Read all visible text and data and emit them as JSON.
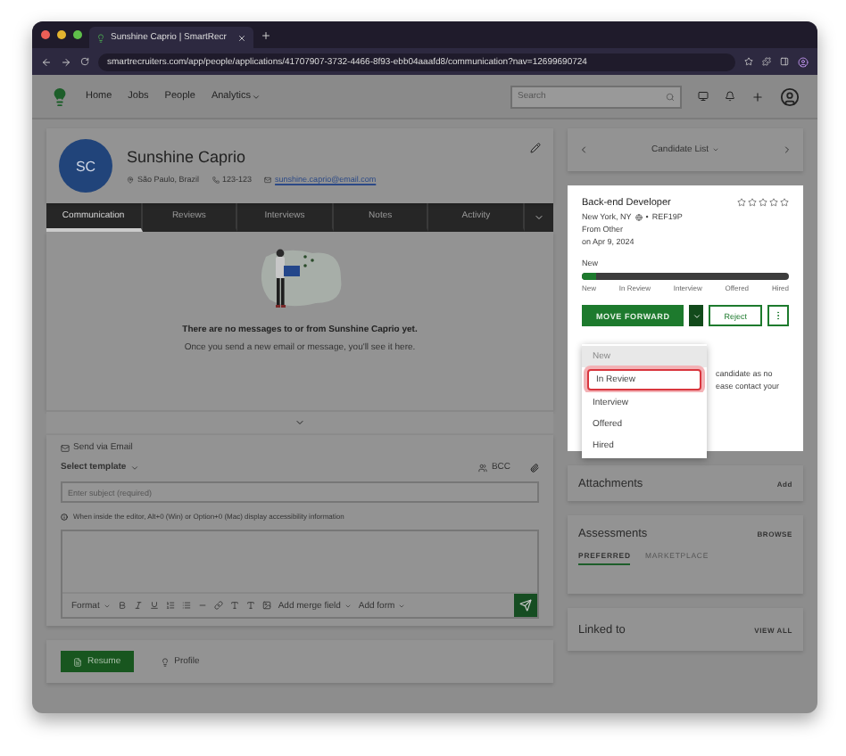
{
  "browser": {
    "tab_title": "Sunshine Caprio | SmartRecr",
    "url": "smartrecruiters.com/app/people/applications/41707907-3732-4466-8f93-ebb04aaafd8/communication?nav=12699690724"
  },
  "nav": {
    "items": [
      {
        "label": "Home"
      },
      {
        "label": "Jobs"
      },
      {
        "label": "People"
      },
      {
        "label": "Analytics",
        "kind": "menu"
      }
    ],
    "search": {
      "placeholder": "Search"
    }
  },
  "candidate": {
    "initials": "SC",
    "name": "Sunshine Caprio",
    "location": "São Paulo, Brazil",
    "phone": "123-123",
    "email": "sunshine.caprio@email.com"
  },
  "tabs": [
    {
      "label": "Communication",
      "selected": true
    },
    {
      "label": "Reviews",
      "selected": false
    },
    {
      "label": "Interviews",
      "selected": false
    },
    {
      "label": "Notes",
      "selected": false
    },
    {
      "label": "Activity",
      "selected": false
    }
  ],
  "empty_state": {
    "title": "There are no messages to or from Sunshine Caprio yet.",
    "subtitle": "Once you send a new email or message, you'll see it here."
  },
  "compose": {
    "channel": "Send via Email",
    "template": "Select template",
    "bcc": "BCC",
    "subject": {
      "placeholder": "Enter subject (required)"
    },
    "hint": "When inside the editor, Alt+0 (Win) or Option+0 (Mac) display accessibility information",
    "format": "Format",
    "merge_field": "Add merge field",
    "form": "Add form"
  },
  "bottom_tabs": [
    {
      "label": "Resume",
      "selected": true
    },
    {
      "label": "Profile",
      "selected": false
    }
  ],
  "sidebar": {
    "candidate_list": "Candidate List",
    "job": {
      "title": "Back-end Developer",
      "location": "New York, NY",
      "ref_separator": "•",
      "ref": "REF19P",
      "source": "From Other",
      "date": "on Apr 9, 2024",
      "stars": 0,
      "status": "New",
      "level": 0.07,
      "stages": [
        "New",
        "In Review",
        "Interview",
        "Offered",
        "Hired"
      ],
      "move_forward": "MOVE FORWARD",
      "reject": "Reject",
      "note_lines": [
        "candidate as no",
        "ease contact your"
      ],
      "menu": [
        {
          "label": "New",
          "selected": false,
          "disabled": true
        },
        {
          "label": "In Review",
          "selected": true,
          "disabled": false
        },
        {
          "label": "Interview",
          "selected": false,
          "disabled": false
        },
        {
          "label": "Offered",
          "selected": false,
          "disabled": false
        },
        {
          "label": "Hired",
          "selected": false,
          "disabled": false
        }
      ]
    },
    "attachments": {
      "title": "Attachments",
      "action": "Add"
    },
    "assessments": {
      "title": "Assessments",
      "action": "BROWSE",
      "tabs": [
        {
          "label": "PREFERRED",
          "selected": true
        },
        {
          "label": "MARKETPLACE",
          "selected": false
        }
      ]
    },
    "linked": {
      "title": "Linked to",
      "action": "VIEW ALL"
    }
  }
}
